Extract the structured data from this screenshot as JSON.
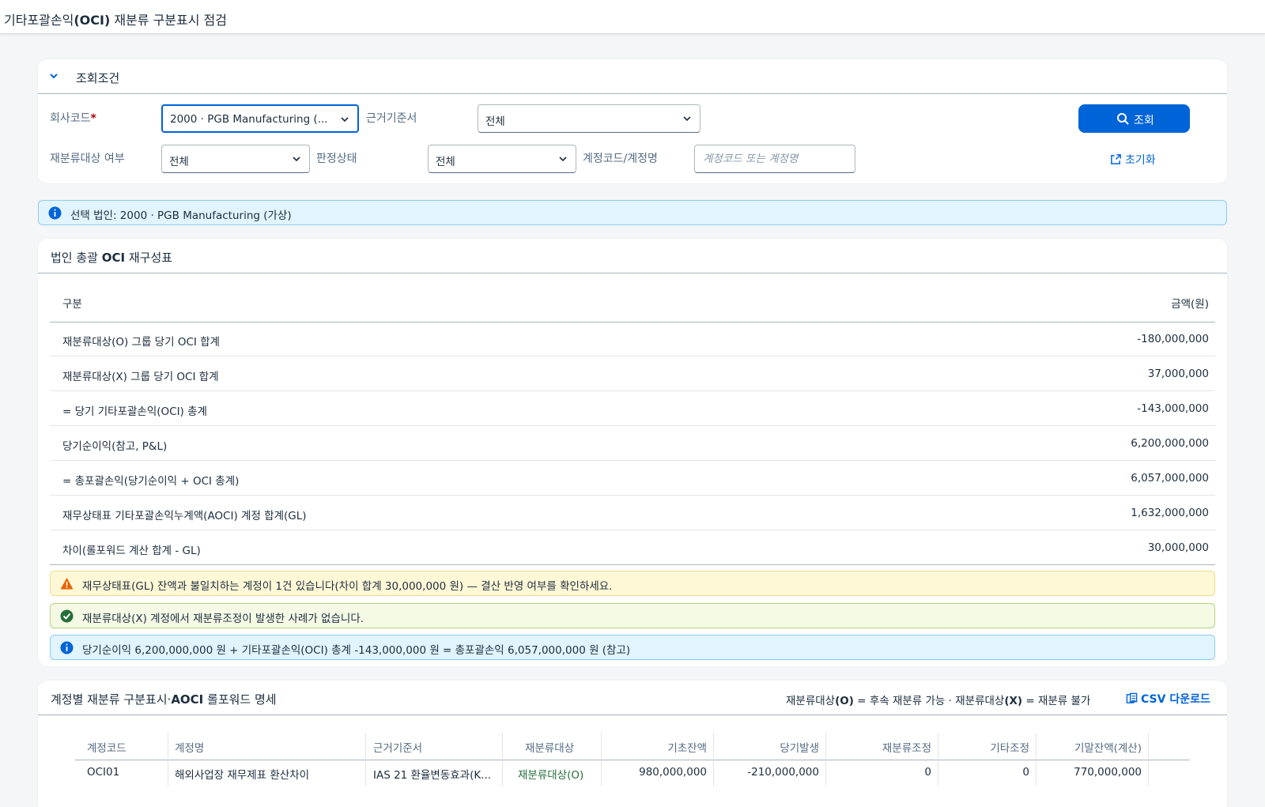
{
  "app": {
    "title_prefix": "기타포괄손익",
    "title_bold": "(OCI)",
    "title_suffix": " 재분류 구분표시 점검"
  },
  "filter": {
    "panel_title": "조회조건",
    "company_label": "회사코드",
    "company_required": "*",
    "company_value": "2000 · PGB Manufacturing (...",
    "basis_label": "근거기준서",
    "basis_value": "전체",
    "reclass_label": "재분류대상 여부",
    "reclass_value": "전체",
    "status_label": "판정상태",
    "status_value": "전체",
    "account_label": "계정코드/계정명",
    "account_placeholder": "계정코드 또는 계정명",
    "search_label": "조회",
    "reset_label": "초기화"
  },
  "selected_entity": "선택 법인: 2000 · PGB Manufacturing (가상)",
  "summary": {
    "title_pre": "법인 총괄 ",
    "title_bold": "OCI",
    "title_post": " 재구성표",
    "col_label": "구분",
    "col_amount": "금액(원)",
    "rows": [
      {
        "label": "재분류대상(O) 그룹 당기 OCI 합계",
        "amount": "-180,000,000"
      },
      {
        "label": "재분류대상(X) 그룹 당기 OCI 합계",
        "amount": "37,000,000"
      },
      {
        "label": "= 당기 기타포괄손익(OCI) 총계",
        "amount": "-143,000,000"
      },
      {
        "label": "당기순이익(참고, P&L)",
        "amount": "6,200,000,000"
      },
      {
        "label": "= 총포괄손익(당기순이익 + OCI 총계)",
        "amount": "6,057,000,000"
      },
      {
        "label": "재무상태표 기타포괄손익누계액(AOCI) 계정 합계(GL)",
        "amount": "1,632,000,000"
      },
      {
        "label": "차이(롤포워드 계산 합계 - GL)",
        "amount": "30,000,000"
      }
    ],
    "msg_warn": "재무상태표(GL) 잔액과 불일치하는 계정이 1건 있습니다(차이 합계 30,000,000 원) — 결산 반영 여부를 확인하세요.",
    "msg_ok": "재분류대상(X) 계정에서 재분류조정이 발생한 사례가 없습니다.",
    "msg_info": "당기순이익 6,200,000,000 원 + 기타포괄손익(OCI) 총계 -143,000,000 원 = 총포괄손익 6,057,000,000 원 (참고)"
  },
  "detail": {
    "title_pre": "계정별 재분류 구분표시·",
    "title_bold": "AOCI",
    "title_post": " 롤포워드 명세",
    "legend_1": "재분류대상",
    "legend_2": "(O)",
    "legend_3": " = 후속 재분류 가능 · 재분류대상",
    "legend_4": "(X)",
    "legend_5": " = 재분류 불가",
    "csv_label": "CSV 다운로드",
    "columns": [
      "계정코드",
      "계정명",
      "근거기준서",
      "재분류대상",
      "기초잔액",
      "당기발생",
      "재분류조정",
      "기타조정",
      "기말잔액(계산)"
    ],
    "rows": [
      {
        "code": "OCI01",
        "name": "해외사업장 재무제표 환산차이",
        "basis": "IAS 21 환율변동효과(K...",
        "reclass": "재분류대상(O)",
        "opening": "980,000,000",
        "current": "-210,000,000",
        "reclass_adj": "0",
        "other_adj": "0",
        "closing": "770,000,000"
      }
    ]
  },
  "colors": {
    "accent": "#0064d9",
    "ok_text": "#256f3a"
  }
}
